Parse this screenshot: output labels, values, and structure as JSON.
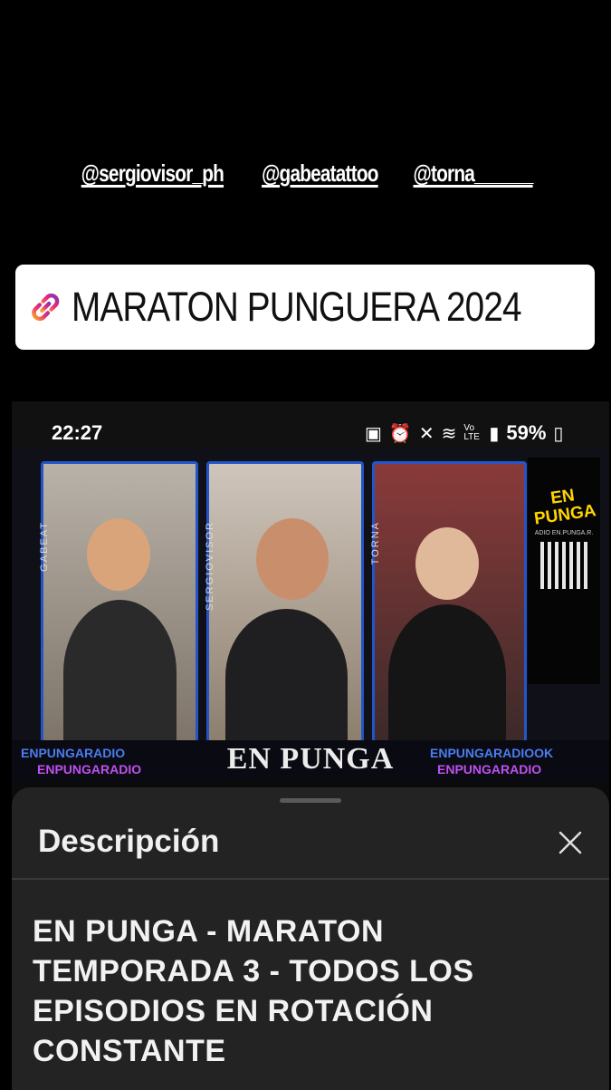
{
  "story": {
    "mentions": [
      "@sergiovisor_ph",
      "@gabeatattoo",
      "@torna______"
    ],
    "link_sticker": {
      "icon": "link-icon",
      "label": "MARATON PUNGUERA 2024"
    }
  },
  "screenshot": {
    "status_bar": {
      "time": "22:27",
      "network": "Vo LTE",
      "battery": "59%"
    },
    "video": {
      "panel_labels": [
        "GABEAT",
        "SERGIOVISOR",
        "TORNA"
      ],
      "logo": {
        "line1": "EN",
        "line2": "PUNGA",
        "sub": "ADIO    EN.PUNGA.R."
      },
      "banner": {
        "center": "EN PUNGA",
        "left_top": "ENPUNGARADIO",
        "left_bottom": "ENPUNGARADIO",
        "right_top": "ENPUNGARADIOOK",
        "right_bottom": "ENPUNGARADIO"
      }
    },
    "sheet": {
      "title": "Descripción",
      "description": "EN PUNGA  - MARATON TEMPORADA 3 - TODOS LOS EPISODIOS EN ROTACIÓN CONSTANTE"
    }
  }
}
